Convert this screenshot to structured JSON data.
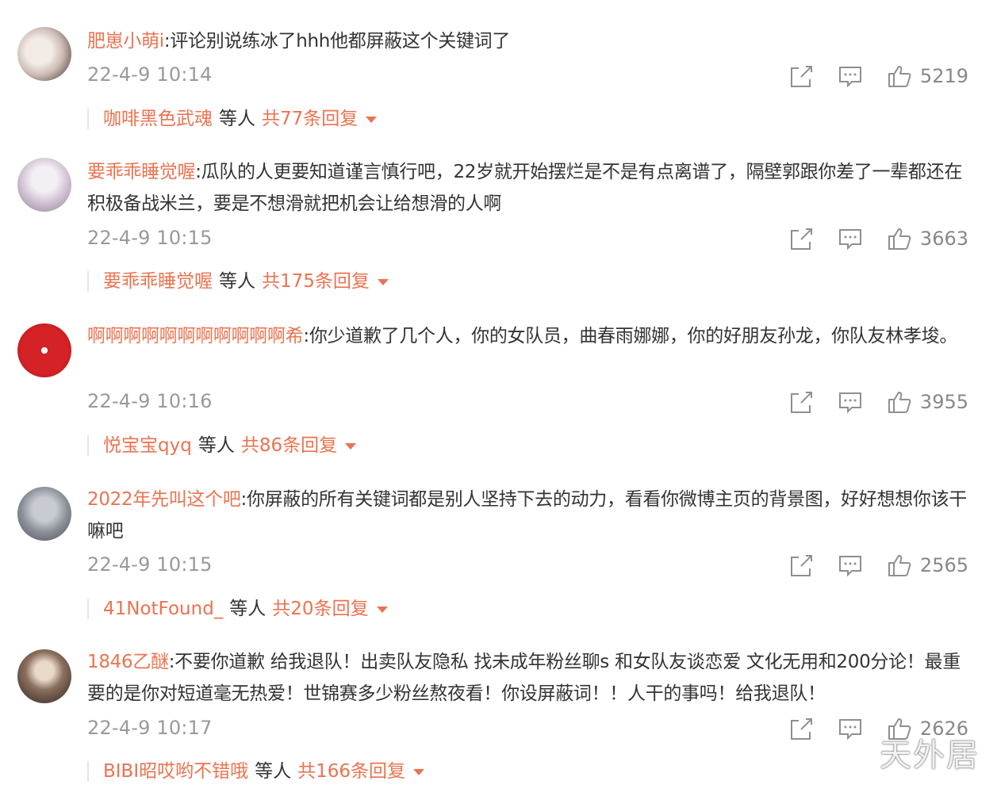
{
  "comments": [
    {
      "user": "肥崽小萌i",
      "text": ":评论别说练冰了hhh他都屏蔽这个关键词了",
      "time": "22-4-9 10:14",
      "likes": "5219",
      "reply_user": "咖啡黑色武魂",
      "reply_sep": "等人",
      "reply_count": "共77条回复",
      "avatar_colors": [
        "#e9d9d2",
        "#3a2d2a"
      ]
    },
    {
      "user": "要乖乖睡觉喔",
      "text": ":瓜队的人更要知道谨言慎行吧，22岁就开始摆烂是不是有点离谱了，隔壁郭跟你差了一辈都还在积极备战米兰，要是不想滑就把机会让给想滑的人啊",
      "time": "22-4-9 10:15",
      "likes": "3663",
      "reply_user": "要乖乖睡觉喔",
      "reply_sep": "等人",
      "reply_count": "共175条回复",
      "avatar_colors": [
        "#e6dde8",
        "#b9a9bf"
      ]
    },
    {
      "user": "啊啊啊啊啊啊啊啊啊啊啊希",
      "text": ":你少道歉了几个人，你的女队员，曲春雨娜娜，你的好朋友孙龙，你队友林孝埈。",
      "time": "22-4-9 10:16",
      "likes": "3955",
      "reply_user": "悦宝宝qyq",
      "reply_sep": "等人",
      "reply_count": "共86条回复",
      "avatar_colors": [
        "#c81e22",
        "#8a0f12"
      ]
    },
    {
      "user": "2022年先叫这个吧",
      "text": ":你屏蔽的所有关键词都是别人坚持下去的动力，看看你微博主页的背景图，好好想想你该干嘛吧",
      "time": "22-4-9 10:15",
      "likes": "2565",
      "reply_user": "41NotFound_",
      "reply_sep": "等人",
      "reply_count": "共20条回复",
      "avatar_colors": [
        "#9aa0a8",
        "#4d5058"
      ]
    },
    {
      "user": "1846乙醚",
      "text": ":不要你道歉 给我退队！出卖队友隐私 找未成年粉丝聊s 和女队友谈恋爱 文化无用和200分论！最重要的是你对短道毫无热爱！世锦赛多少粉丝熬夜看！你设屏蔽词！！人干的事吗！给我退队！",
      "time": "22-4-9 10:17",
      "likes": "2626",
      "reply_user": "BIBI昭哎哟不错哦",
      "reply_sep": "等人",
      "reply_count": "共166条回复",
      "avatar_colors": [
        "#c9b9a8",
        "#2b2220"
      ]
    }
  ],
  "watermark": "天外居"
}
